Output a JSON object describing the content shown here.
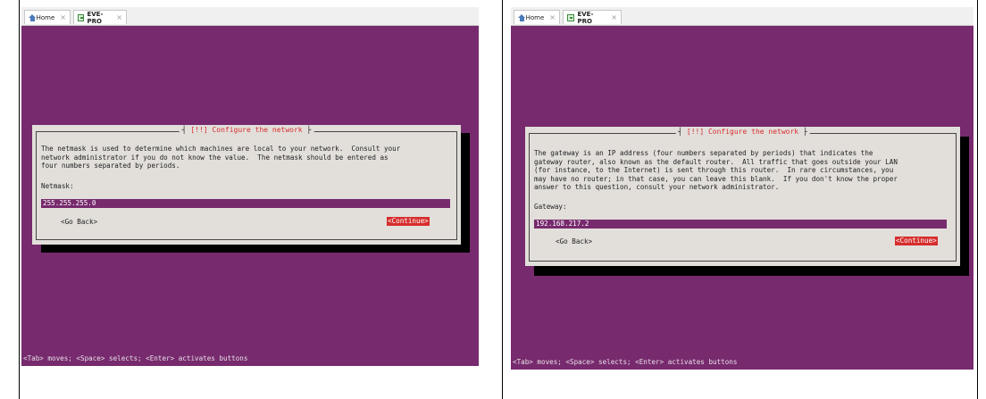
{
  "tabs": [
    {
      "label": "Home",
      "close": "×",
      "icon": "home-icon"
    },
    {
      "label": "EVE-PRO",
      "close": "×",
      "icon": "vm-icon"
    }
  ],
  "left": {
    "dialog_title": "[!!] Configure the network",
    "description": "The netmask is used to determine which machines are local to your network.  Consult your\nnetwork administrator if you do not know the value.  The netmask should be entered as\nfour numbers separated by periods.",
    "field_label": "Netmask:",
    "field_value": "255.255.255.0",
    "back_label": "<Go Back>",
    "continue_label": "<Continue>",
    "status": "<Tab> moves; <Space> selects; <Enter> activates buttons"
  },
  "right": {
    "dialog_title": "[!!] Configure the network",
    "description": "The gateway is an IP address (four numbers separated by periods) that indicates the\ngateway router, also known as the default router.  All traffic that goes outside your LAN\n(for instance, to the Internet) is sent through this router.  In rare circumstances, you\nmay have no router; in that case, you can leave this blank.  If you don't know the proper\nanswer to this question, consult your network administrator.",
    "field_label": "Gateway:",
    "field_value": "192.168.217.2",
    "back_label": "<Go Back>",
    "continue_label": "<Continue>",
    "status": "<Tab> moves; <Space> selects; <Enter> activates buttons"
  },
  "colors": {
    "screen_bg": "#772a6d",
    "dialog_bg": "#e2dfdb",
    "accent_red": "#d62d2d"
  }
}
